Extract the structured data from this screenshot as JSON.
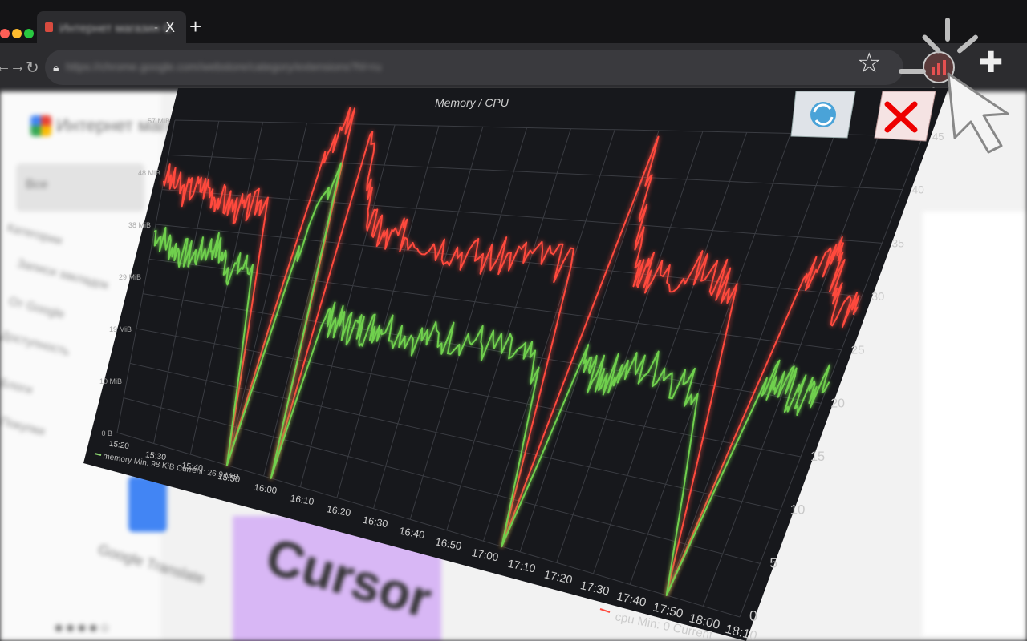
{
  "browser": {
    "tab_title": "Интернет магазин Chrome",
    "tab_separator": "-",
    "tab_close": "X",
    "new_tab": "+",
    "url": "https://chrome.google.com/webstore/category/extensions?hl=ru",
    "icons": [
      "back-icon",
      "forward-icon",
      "reload-icon",
      "lock-icon",
      "star-icon",
      "memory-cpu-extension-icon",
      "puzzle-icon"
    ],
    "traffic_lights": [
      "#ff5f57",
      "#febc2e",
      "#28c840"
    ]
  },
  "page": {
    "store_title": "Интернет магазин",
    "search_value": "Все",
    "sidebar_heading": "Все",
    "sidebar_items": [
      "Категории",
      "Записи закладок",
      "От Google",
      "Доступность",
      "Блоги",
      "Покупки"
    ],
    "app_names": [
      "Google Translate",
      "Cursor"
    ],
    "rating": "★★★★☆"
  },
  "chart_panel": {
    "refresh_label": "refresh-icon",
    "close_label": "close-icon"
  },
  "chart_data": {
    "type": "line",
    "title": "Memory / CPU",
    "left_axis": {
      "ticks": [
        "57 MiB",
        "48 MiB",
        "38 MiB",
        "29 MiB",
        "19 MiB",
        "10 MiB",
        "0 B"
      ],
      "ylim": [
        0,
        57
      ]
    },
    "right_axis": {
      "ticks": [
        "45",
        "40",
        "35",
        "30",
        "25",
        "20",
        "15",
        "10",
        "5",
        "0"
      ],
      "ylim": [
        0,
        45
      ]
    },
    "x_ticks": [
      "15:20",
      "15:30",
      "15:40",
      "15:50",
      "16:00",
      "16:10",
      "16:20",
      "16:30",
      "16:40",
      "16:50",
      "17:00",
      "17:10",
      "17:20",
      "17:30",
      "17:40",
      "17:50",
      "18:00",
      "18:10"
    ],
    "legend": {
      "memory": "memory  Min: 98 KiB  Current: 26.9 MiB",
      "cpu": "cpu  Min: 0  Current"
    },
    "series": [
      {
        "name": "cpu",
        "color": "#ff4a3d",
        "x": [
          "15:20",
          "15:25",
          "15:30",
          "15:35",
          "15:40",
          "15:45",
          "15:50",
          "15:55",
          "16:00",
          "16:02",
          "16:05",
          "16:10",
          "16:15",
          "16:20",
          "16:30",
          "16:40",
          "16:50",
          "17:00",
          "17:05",
          "17:10",
          "17:15",
          "17:20",
          "17:30",
          "17:40",
          "17:50",
          "17:55",
          "18:00",
          "18:05",
          "18:10"
        ],
        "values": [
          37,
          35,
          36,
          34,
          33,
          35,
          0,
          38,
          47,
          0,
          44,
          33,
          31,
          32,
          31,
          30,
          31,
          30,
          0,
          43,
          31,
          30,
          31,
          30,
          0,
          31,
          34,
          29,
          29
        ]
      },
      {
        "name": "memory",
        "color": "#6fd04e",
        "x": [
          "15:20",
          "15:25",
          "15:30",
          "15:35",
          "15:40",
          "15:45",
          "15:50",
          "15:55",
          "16:00",
          "16:02",
          "16:05",
          "16:10",
          "16:15",
          "16:20",
          "16:30",
          "16:40",
          "16:50",
          "17:00",
          "17:05",
          "17:10",
          "17:15",
          "17:20",
          "17:30",
          "17:40",
          "17:50",
          "17:55",
          "18:00",
          "18:05",
          "18:10"
        ],
        "values": [
          29,
          27,
          26,
          28,
          25,
          26,
          0,
          28,
          40,
          0,
          21,
          20,
          20,
          21,
          20,
          21,
          20,
          19,
          0,
          20,
          19,
          20,
          21,
          19,
          0,
          22,
          21,
          20,
          22
        ]
      }
    ]
  }
}
